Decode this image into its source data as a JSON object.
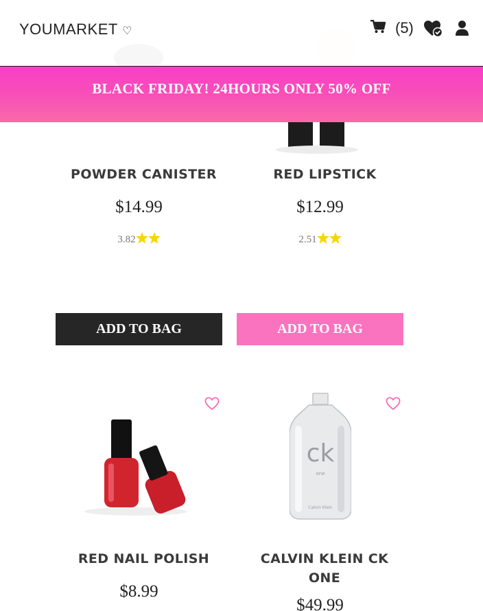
{
  "header": {
    "logo_text": "YOUMARKET",
    "logo_heart": "♡",
    "cart_count": "(5)"
  },
  "banner": {
    "text": "BLACK FRIDAY! 24HOURS ONLY 50% OFF"
  },
  "products": [
    {
      "title": "POWDER CANISTER",
      "price": "$14.99",
      "rating": "3.82",
      "button": "ADD TO BAG"
    },
    {
      "title": "RED LIPSTICK",
      "price": "$12.99",
      "rating": "2.51",
      "button": "ADD TO BAG"
    },
    {
      "title": "RED NAIL POLISH",
      "price": "$8.99"
    },
    {
      "title": "CALVIN KLEIN CK ONE",
      "price": "$49.99",
      "bottle_brand": "ck",
      "bottle_sub": "one",
      "bottle_label": "Calvin Klein"
    }
  ],
  "colors": {
    "accent_pink": "#fa73bf",
    "banner_pink": "#f73fc7",
    "star_yellow": "#f5d800",
    "dark_button": "#262626"
  }
}
